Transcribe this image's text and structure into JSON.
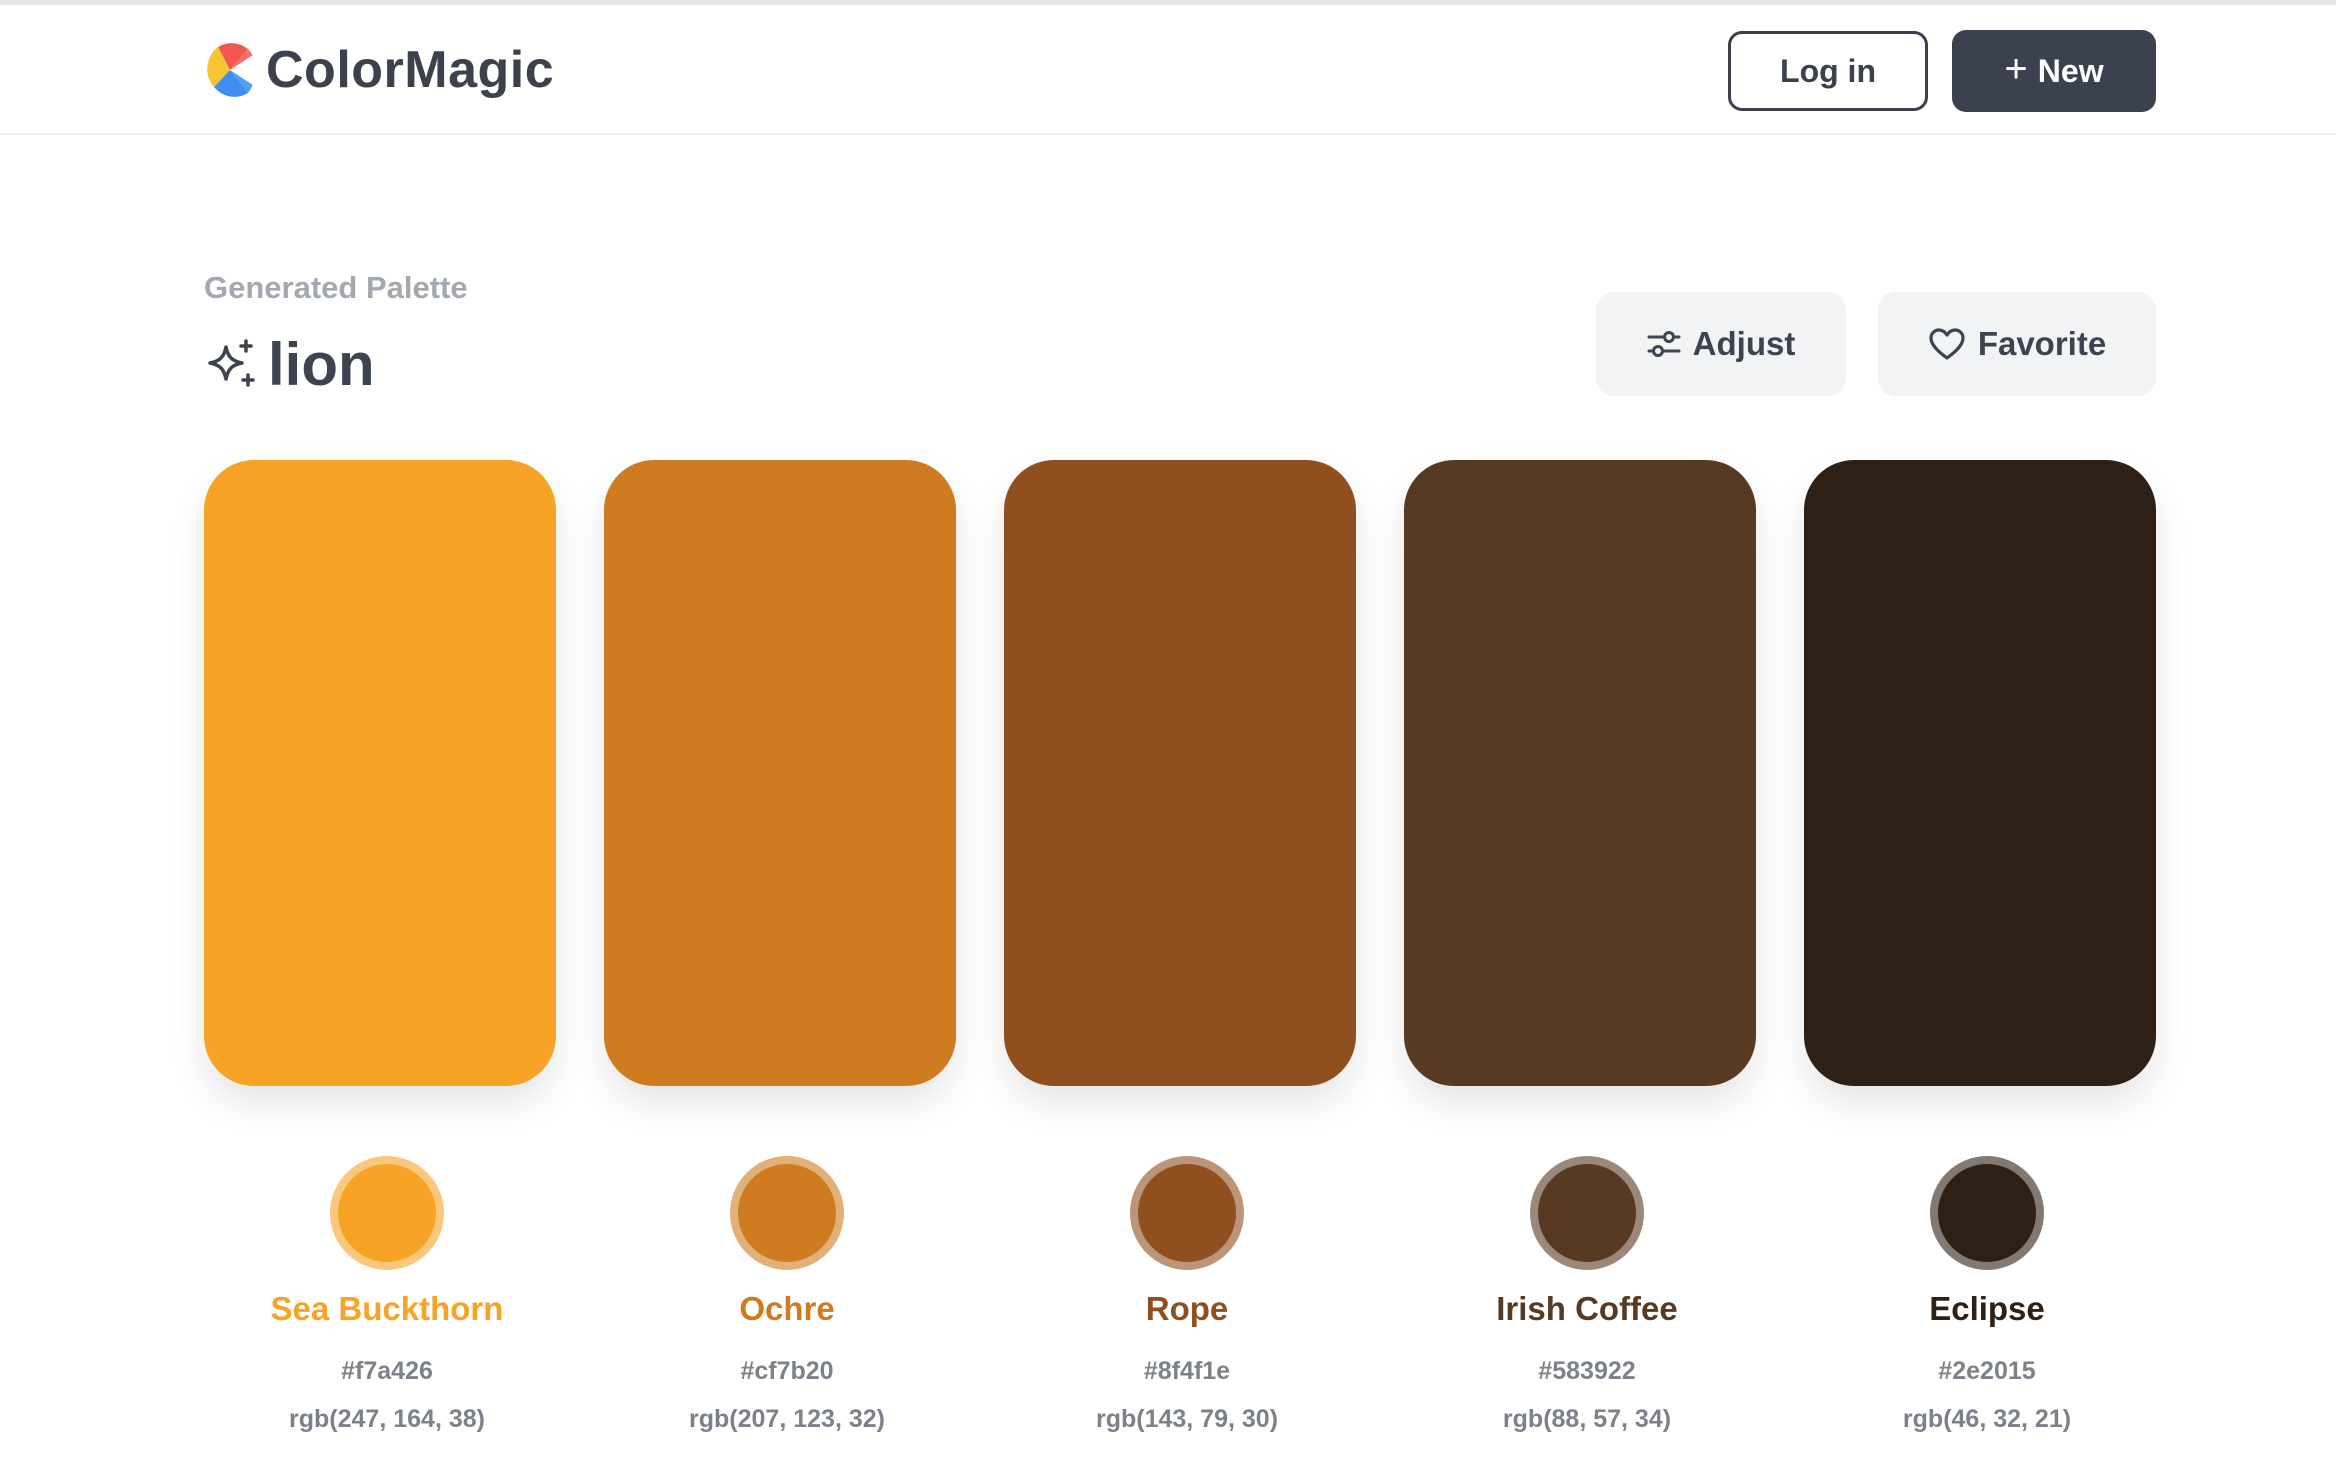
{
  "header": {
    "brand": "ColorMagic",
    "login_label": "Log in",
    "new_label": "New"
  },
  "palette": {
    "subtitle": "Generated Palette",
    "title": "lion",
    "adjust_label": "Adjust",
    "favorite_label": "Favorite",
    "colors": [
      {
        "name": "Sea Buckthorn",
        "hex": "#f7a426",
        "rgb": "rgb(247, 164, 38)"
      },
      {
        "name": "Ochre",
        "hex": "#cf7b20",
        "rgb": "rgb(207, 123, 32)"
      },
      {
        "name": "Rope",
        "hex": "#8f4f1e",
        "rgb": "rgb(143, 79, 30)"
      },
      {
        "name": "Irish Coffee",
        "hex": "#583922",
        "rgb": "rgb(88, 57, 34)"
      },
      {
        "name": "Eclipse",
        "hex": "#2e2015",
        "rgb": "rgb(46, 32, 21)"
      }
    ]
  },
  "colors": {
    "primary_dark": "#3b414e",
    "button_light_bg": "#f2f3f5",
    "muted_text": "#7c818b"
  }
}
